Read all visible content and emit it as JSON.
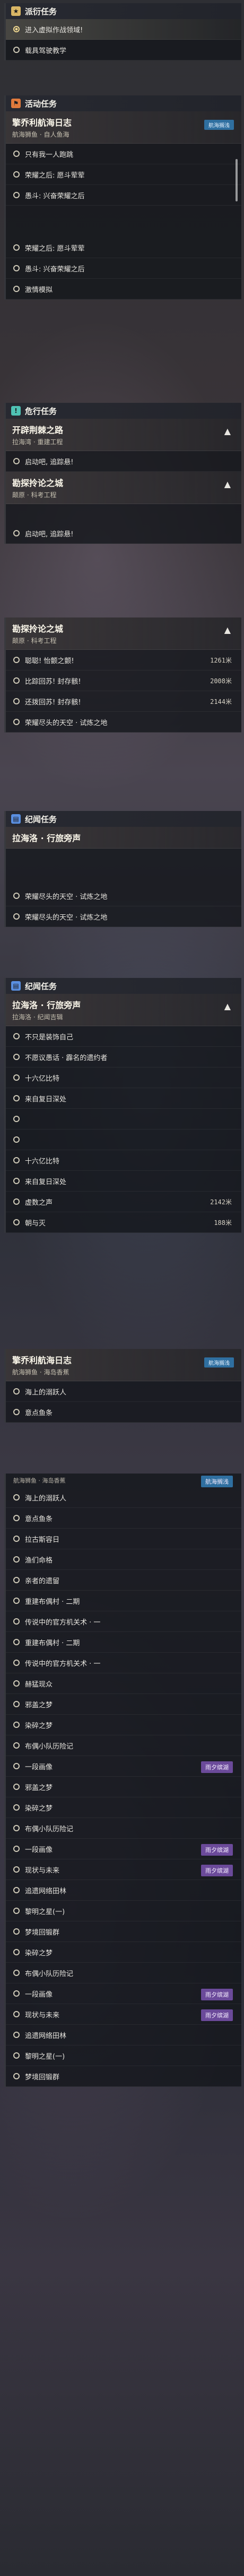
{
  "s1": {
    "title": "派衍任务",
    "rows": [
      "进入虚拟作战领域!",
      "载具驾驶教学"
    ]
  },
  "s2": {
    "title": "活动任务",
    "quest_title": "擎乔利航海日志",
    "quest_sub": "航海狮鱼 · 自人鱼海",
    "tag": "航海搁浅",
    "rows": [
      "只有我一人跑跳",
      "荣耀之后: 愿斗荤荤",
      "愚斗: 兴奋荣耀之后",
      "荣耀之后: 愿斗荤荤",
      "愚斗: 兴奋荣耀之后",
      "激情模拟"
    ]
  },
  "s3": {
    "title": "危行任务",
    "q1_title": "开辟荆棘之路",
    "q1_sub": "拉海湾 · 重建工程",
    "q1_rows": [
      "启动吧, 追踪悬!"
    ],
    "q2_title": "勘探拎论之城",
    "q2_sub": "颠原 · 科考工程",
    "q2_rows": [
      "启动吧, 追踪悬!"
    ]
  },
  "s4": {
    "q_title": "勘探拎论之城",
    "q_sub": "颠原 · 科考工程",
    "rows": [
      {
        "label": "聪聪! 怡颤之颤!",
        "val": "1261米"
      },
      {
        "label": "比踪回苏! 封存骸!",
        "val": "2008米"
      },
      {
        "label": "还拨回苏! 封存骸!",
        "val": "2144米"
      },
      {
        "label": "荣耀尽头的天空 · 试炼之地",
        "val": ""
      }
    ]
  },
  "s5": {
    "title": "纪闻任务",
    "quest_title": "拉海洛 · 行旅旁声",
    "rows": [
      "荣耀尽头的天空 · 试炼之地",
      "荣耀尽头的天空 · 试炼之地"
    ]
  },
  "s6": {
    "title": "纪闻任务",
    "quest_title": "拉海洛 · 行旅旁声",
    "quest_sub": "拉海洛 · 纪闻吉辑",
    "rows": [
      {
        "label": "不只是装饰自己",
        "val": ""
      },
      {
        "label": "不愿议愚话 · 霹名的遗约者",
        "val": ""
      },
      {
        "label": "十六亿比特",
        "val": ""
      },
      {
        "label": "来自复日深处",
        "val": ""
      },
      {
        "label": "",
        "val": ""
      },
      {
        "label": "",
        "val": ""
      },
      {
        "label": "十六亿比特",
        "val": ""
      },
      {
        "label": "来自复日深处",
        "val": ""
      },
      {
        "label": "虚数之声",
        "val": "2142米"
      },
      {
        "label": "朝与灭",
        "val": "188米"
      }
    ]
  },
  "s7": {
    "quest_title": "擎乔利航海日志",
    "quest_sub": "航海狮鱼 · 海岛香蕉",
    "tag": "航海搁浅",
    "rows": [
      "海上的溺跃人",
      "意点鱼条"
    ]
  },
  "s8": {
    "sub": "航海狮鱼 · 海岛香蕉",
    "tag": "航海搁浅",
    "rows": [
      {
        "label": "海上的溺跃人",
        "ev": ""
      },
      {
        "label": "意点鱼条",
        "ev": ""
      },
      {
        "label": "拉古斯容日",
        "ev": ""
      },
      {
        "label": "渔们命格",
        "ev": ""
      },
      {
        "label": "亲者的遗留",
        "ev": ""
      },
      {
        "label": "重建布偶村 · 二期",
        "ev": ""
      },
      {
        "label": "传说中的官方机关术 · 一",
        "ev": ""
      },
      {
        "label": "重建布偶村 · 二期",
        "ev": ""
      },
      {
        "label": "传说中的官方机关术 · 一",
        "ev": ""
      },
      {
        "label": "赫猛现众",
        "ev": ""
      },
      {
        "label": "邪盖之梦",
        "ev": ""
      },
      {
        "label": "染碎之梦",
        "ev": ""
      },
      {
        "label": "布偶小队历险记",
        "ev": ""
      },
      {
        "label": "一段画像",
        "ev": "雨夕缤湖"
      },
      {
        "label": "邪盖之梦",
        "ev": ""
      },
      {
        "label": "染碎之梦",
        "ev": ""
      },
      {
        "label": "布偶小队历险记",
        "ev": ""
      },
      {
        "label": "一段画像",
        "ev": "雨夕缤湖"
      },
      {
        "label": "现状与未来",
        "ev": "雨夕缤湖"
      },
      {
        "label": "追遗网络田林",
        "ev": ""
      },
      {
        "label": "黎明之星(一)",
        "ev": ""
      },
      {
        "label": "梦境回锻群",
        "ev": ""
      },
      {
        "label": "染碎之梦",
        "ev": ""
      },
      {
        "label": "布偶小队历险记",
        "ev": ""
      },
      {
        "label": "一段画像",
        "ev": "雨夕缤湖"
      },
      {
        "label": "现状与未来",
        "ev": "雨夕缤湖"
      },
      {
        "label": "追遗网络田林",
        "ev": ""
      },
      {
        "label": "黎明之星(一)",
        "ev": ""
      },
      {
        "label": "梦境回锻群",
        "ev": ""
      }
    ]
  }
}
